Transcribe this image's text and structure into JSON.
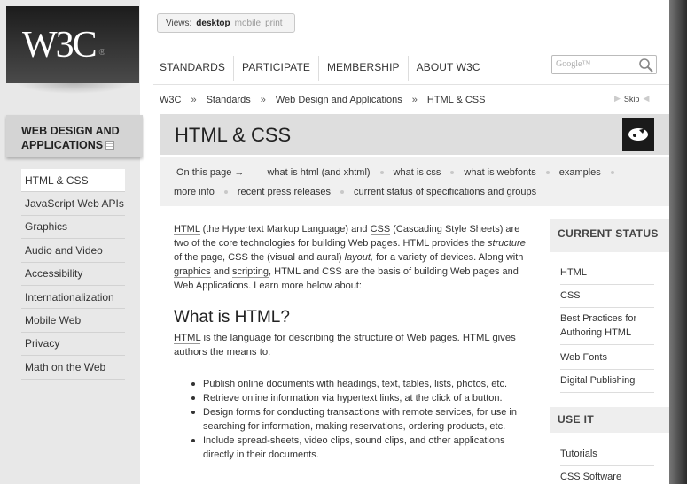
{
  "logo": {
    "text": "W3C",
    "reg": "®"
  },
  "views": {
    "label": "Views:",
    "current": "desktop",
    "options": [
      "mobile",
      "print"
    ]
  },
  "topnav": [
    "STANDARDS",
    "PARTICIPATE",
    "MEMBERSHIP",
    "ABOUT W3C"
  ],
  "search": {
    "placeholder": "Google™"
  },
  "breadcrumb": [
    "W3C",
    "Standards",
    "Web Design and Applications",
    "HTML & CSS"
  ],
  "breadcrumb_sep": "»",
  "skip": "Skip",
  "sidebar": {
    "title": "WEB DESIGN AND APPLICATIONS",
    "items": [
      "HTML & CSS",
      "JavaScript Web APIs",
      "Graphics",
      "Audio and Video",
      "Accessibility",
      "Internationalization",
      "Mobile Web",
      "Privacy",
      "Math on the Web"
    ],
    "active_index": 0
  },
  "page": {
    "title": "HTML & CSS"
  },
  "on_this_page": {
    "label": "On this page →",
    "links_row1": [
      "what is html (and xhtml)",
      "what is css",
      "what is webfonts",
      "examples"
    ],
    "links_row2": [
      "more info",
      "recent press releases",
      "current status of specifications and groups"
    ]
  },
  "intro": {
    "html_link": "HTML",
    "t1": " (the Hypertext Markup Language) and ",
    "css_link": "CSS",
    "t2": " (Cascading Style Sheets) are two of the core technologies for building Web pages. HTML provides the ",
    "structure": "structure",
    "t3": " of the page, CSS the (visual and aural) ",
    "layout": "layout,",
    "t4": " for a variety of devices. Along with ",
    "graphics_link": "graphics",
    "t5": " and ",
    "scripting_link": "scripting",
    "t6": ", HTML and CSS are the basis of building Web pages and Web Applications. Learn more below about:"
  },
  "what_is_html": {
    "heading": "What is HTML?",
    "html_link": "HTML",
    "text": " is the language for describing the structure of Web pages. HTML gives authors the means to:",
    "bullets": [
      "Publish online documents with headings, text, tables, lists, photos, etc.",
      "Retrieve online information via hypertext links, at the click of a button.",
      "Design forms for conducting transactions with remote services, for use in searching for information, making reservations, ordering products, etc.",
      "Include spread-sheets, video clips, sound clips, and other applications directly in their documents."
    ]
  },
  "current_status": {
    "heading": "CURRENT STATUS",
    "links": [
      "HTML",
      "CSS",
      "Best Practices for Authoring HTML",
      "Web Fonts",
      "Digital Publishing"
    ]
  },
  "use_it": {
    "heading": "USE IT",
    "links": [
      "Tutorials",
      "CSS Software"
    ]
  }
}
